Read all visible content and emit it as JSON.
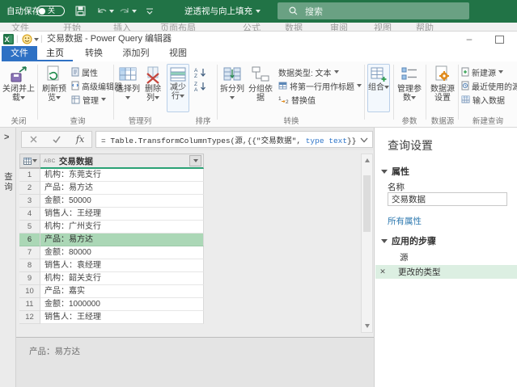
{
  "colors": {
    "excel_green": "#217346",
    "accent_blue": "#2e71c4",
    "header_accent_teal": "#2aa175",
    "selected_row_green": "#abd7b6",
    "selected_step_green": "#dcefe2"
  },
  "excel_bar": {
    "autosave_label": "自动保存",
    "autosave_state": "关",
    "doc_name": "逆透视与向上填充",
    "search_placeholder": "搜索"
  },
  "excel_tabs": {
    "items": [
      "文件",
      "开始",
      "插入",
      "页面布局",
      "公式",
      "数据",
      "审阅",
      "视图",
      "帮助"
    ]
  },
  "pq": {
    "title": "交易数据 - Power Query 编辑器",
    "tabs": {
      "file": "文件",
      "home": "主页",
      "transform": "转换",
      "add_column": "添加列",
      "view": "视图"
    },
    "ribbon": {
      "close_and_load": "关闭并上载",
      "group_close": "关闭",
      "refresh_preview": "刷新预览",
      "properties": "属性",
      "advanced_editor": "高级编辑器",
      "manage": "管理",
      "group_query": "查询",
      "choose_columns": "选择列",
      "remove_columns": "删除列",
      "group_manage_columns": "管理列",
      "reduce_rows": "减少行",
      "group_sort": "排序",
      "split_column": "拆分列",
      "group_by": "分组依据",
      "data_type": "数据类型: 文本",
      "use_first_row": "将第一行用作标题",
      "replace_values": "替换值",
      "group_transform": "转换",
      "combine": "组合",
      "manage_parameters": "管理参数",
      "group_parameters": "参数",
      "data_source_settings": "数据源设置",
      "group_data_source": "数据源",
      "new_source": "新建源",
      "recent_sources": "最近使用的源",
      "enter_data": "输入数据",
      "group_new_query": "新建查询"
    },
    "formula": {
      "pre": "= Table.TransformColumnTypes(源,{{\"交易数据\", ",
      "keyword": "type text",
      "post": "}}"
    },
    "queries_pane": {
      "collapsed_label": "查询"
    },
    "grid": {
      "type_badge": "ABC",
      "column_name": "交易数据",
      "rows": [
        {
          "n": "1",
          "v": "机构：东莞支行"
        },
        {
          "n": "2",
          "v": "产品：易方达"
        },
        {
          "n": "3",
          "v": "金额：50000"
        },
        {
          "n": "4",
          "v": "销售人：王经理"
        },
        {
          "n": "5",
          "v": "机构：广州支行"
        },
        {
          "n": "6",
          "v": "产品：易方达"
        },
        {
          "n": "7",
          "v": "金额：80000"
        },
        {
          "n": "8",
          "v": "销售人：袁经理"
        },
        {
          "n": "9",
          "v": "机构：韶关支行"
        },
        {
          "n": "10",
          "v": "产品：嘉实"
        },
        {
          "n": "11",
          "v": "金额：1000000"
        },
        {
          "n": "12",
          "v": "销售人：王经理"
        }
      ]
    },
    "preview_text": "产品：易方达",
    "settings": {
      "title": "查询设置",
      "properties_header": "属性",
      "name_label": "名称",
      "name_value": "交易数据",
      "all_properties_link": "所有属性",
      "steps_header": "应用的步骤",
      "steps": [
        {
          "label": "源"
        },
        {
          "label": "更改的类型"
        }
      ]
    }
  }
}
